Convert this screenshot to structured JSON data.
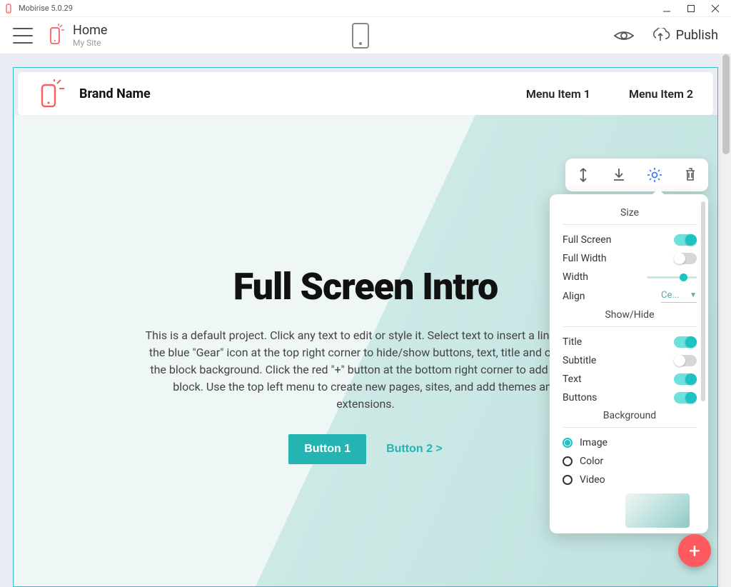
{
  "titlebar": {
    "title": "Mobirise 5.0.29"
  },
  "toolbar": {
    "page_name": "Home",
    "site_name": "My Site",
    "publish_label": "Publish"
  },
  "site_header": {
    "brand": "Brand Name",
    "menu": [
      "Menu Item 1",
      "Menu Item 2"
    ]
  },
  "hero": {
    "title": "Full Screen Intro",
    "desc": "This is a default project. Click any text to edit or style it. Select text to insert a link. Click the blue \"Gear\" icon at the top right corner to hide/show buttons, text, title and change the block background. Click the red \"+\" button at the bottom right corner to add a new block. Use the top left menu to create new pages, sites, and add themes and extensions.",
    "button1": "Button 1",
    "button2": "Button 2 >"
  },
  "panel": {
    "sections": {
      "size": {
        "title": "Size",
        "full_screen": "Full Screen",
        "full_width": "Full Width",
        "width": "Width",
        "align": "Align",
        "align_value": "Ce..."
      },
      "showhide": {
        "title": "Show/Hide",
        "title_toggle": "Title",
        "subtitle": "Subtitle",
        "text": "Text",
        "buttons": "Buttons"
      },
      "background": {
        "title": "Background",
        "image": "Image",
        "color": "Color",
        "video": "Video"
      }
    },
    "values": {
      "full_screen": true,
      "full_width": false,
      "title_on": true,
      "subtitle_on": false,
      "text_on": true,
      "buttons_on": true,
      "bg_selected": "image"
    }
  }
}
